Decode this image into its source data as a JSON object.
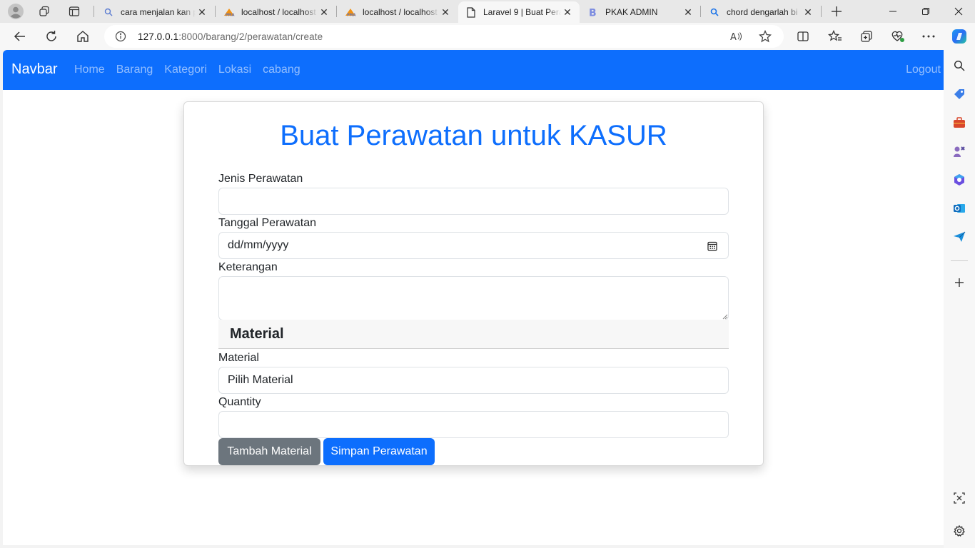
{
  "browser": {
    "tabs": [
      {
        "title": "cara menjalan kan p",
        "icon": "search-icon"
      },
      {
        "title": "localhost / localhost",
        "icon": "phpmyadmin-icon"
      },
      {
        "title": "localhost / localhost",
        "icon": "phpmyadmin-icon"
      },
      {
        "title": "Laravel 9 | Buat Pera",
        "icon": "page-icon",
        "active": true
      },
      {
        "title": "PKAK ADMIN",
        "icon": "bootstrap-icon"
      },
      {
        "title": "chord dengarlah bi",
        "icon": "search-icon"
      }
    ],
    "url_host": "127.0.0.1",
    "url_rest": ":8000/barang/2/perawatan/create",
    "accent": "#0d6efd"
  },
  "navbar": {
    "brand": "Navbar",
    "links": [
      "Home",
      "Barang",
      "Kategori",
      "Lokasi",
      "cabang"
    ],
    "logout": "Logout",
    "bg": "#0d6efd"
  },
  "form": {
    "title": "Buat Perawatan untuk KASUR",
    "jenis_label": "Jenis Perawatan",
    "jenis_value": "",
    "tanggal_label": "Tanggal Perawatan",
    "tanggal_placeholder": "dd/mm/yyyy",
    "keterangan_label": "Keterangan",
    "keterangan_value": "",
    "material_section": "Material",
    "material_label": "Material",
    "material_selected": "Pilih Material",
    "quantity_label": "Quantity",
    "quantity_value": "",
    "add_button": "Tambah Material",
    "save_button": "Simpan Perawatan"
  }
}
